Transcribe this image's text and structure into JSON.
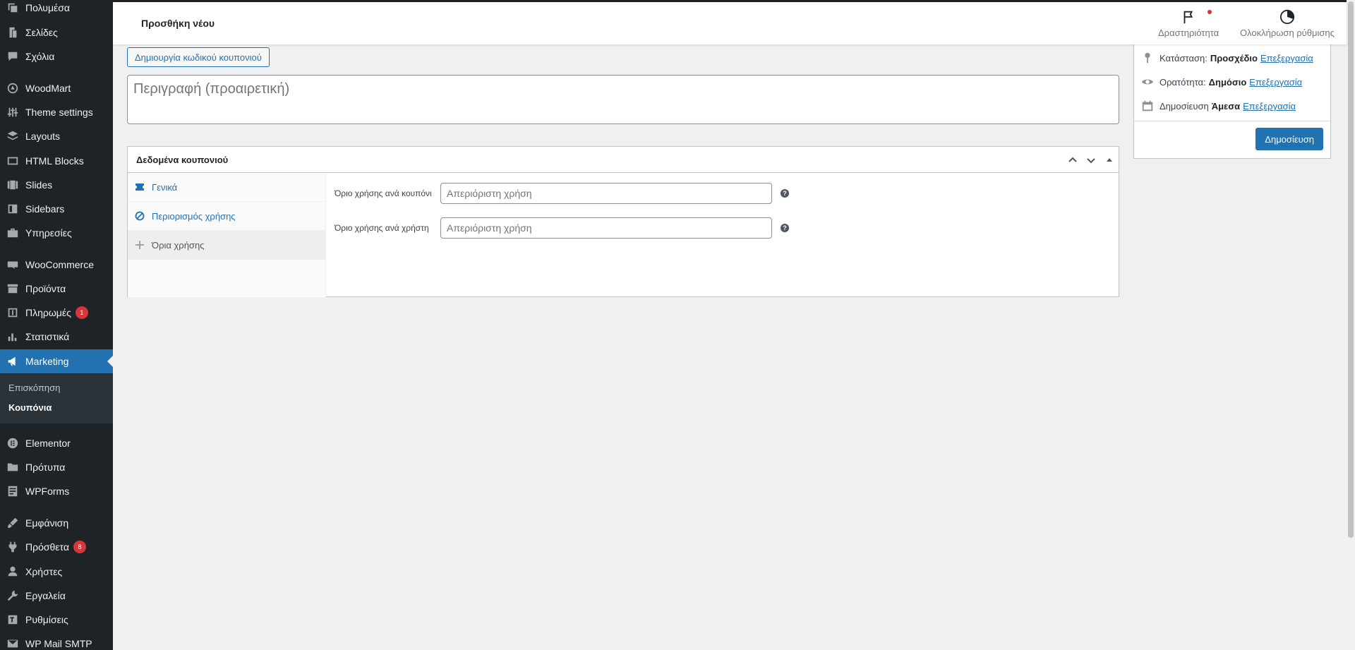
{
  "sidebar": {
    "items": [
      {
        "label": "Πολυμέσα",
        "icon": "media-icon"
      },
      {
        "label": "Σελίδες",
        "icon": "pages-icon"
      },
      {
        "label": "Σχόλια",
        "icon": "comments-icon"
      },
      {
        "label": "WoodMart",
        "icon": "woodmart-icon"
      },
      {
        "label": "Theme settings",
        "icon": "sliders-icon"
      },
      {
        "label": "Layouts",
        "icon": "layers-icon"
      },
      {
        "label": "HTML Blocks",
        "icon": "html-blocks-icon"
      },
      {
        "label": "Slides",
        "icon": "slides-icon"
      },
      {
        "label": "Sidebars",
        "icon": "sidebars-icon"
      },
      {
        "label": "Υπηρεσίες",
        "icon": "briefcase-icon"
      },
      {
        "label": "WooCommerce",
        "icon": "woocommerce-icon"
      },
      {
        "label": "Προϊόντα",
        "icon": "archive-icon"
      },
      {
        "label": "Πληρωμές",
        "icon": "dollar-icon",
        "badge": "1"
      },
      {
        "label": "Στατιστικά",
        "icon": "chart-bar-icon"
      },
      {
        "label": "Marketing",
        "icon": "megaphone-icon",
        "active": true
      },
      {
        "label": "Elementor",
        "icon": "elementor-icon"
      },
      {
        "label": "Πρότυπα",
        "icon": "folder-icon"
      },
      {
        "label": "WPForms",
        "icon": "forms-icon"
      },
      {
        "label": "Εμφάνιση",
        "icon": "brush-icon"
      },
      {
        "label": "Πρόσθετα",
        "icon": "plugins-icon",
        "badge": "8"
      },
      {
        "label": "Χρήστες",
        "icon": "user-icon"
      },
      {
        "label": "Εργαλεία",
        "icon": "wrench-icon"
      },
      {
        "label": "Ρυθμίσεις",
        "icon": "settings-icon"
      },
      {
        "label": "WP Mail SMTP",
        "icon": "mail-icon"
      }
    ],
    "submenu": [
      {
        "label": "Επισκόπηση"
      },
      {
        "label": "Κουπόνια",
        "current": true
      }
    ]
  },
  "header": {
    "title": "Προσθήκη νέου",
    "activity_label": "Δραστηριότητα",
    "setup_label": "Ολοκλήρωση ρύθμισης"
  },
  "main": {
    "create_code_label": "Δημιουργία κωδικού κουπονιού",
    "description_placeholder": "Περιγραφή (προαιρετική)",
    "coupon_box": {
      "title": "Δεδομένα κουπονιού",
      "tabs": [
        {
          "label": "Γενικά",
          "icon": "ticket-icon"
        },
        {
          "label": "Περιορισμός χρήσης",
          "icon": "block-icon"
        },
        {
          "label": "Όρια χρήσης",
          "icon": "plus-icon",
          "active": true
        }
      ],
      "fields": [
        {
          "label": "Όριο χρήσης ανά κουπόνι",
          "placeholder": "Απεριόριστη χρήση"
        },
        {
          "label": "Όριο χρήσης ανά χρήστη",
          "placeholder": "Απεριόριστη χρήση"
        }
      ]
    }
  },
  "publish": {
    "status_label": "Κατάσταση:",
    "status_value": "Προσχέδιο",
    "visibility_label": "Ορατότητα:",
    "visibility_value": "Δημόσιο",
    "publish_label": "Δημοσίευση",
    "publish_value": "Άμεσα",
    "edit_label": "Επεξεργασία",
    "button_label": "Δημοσίευση"
  },
  "colors": {
    "sidebar_bg": "#1d2327",
    "accent": "#2271b1",
    "badge": "#d63638"
  }
}
